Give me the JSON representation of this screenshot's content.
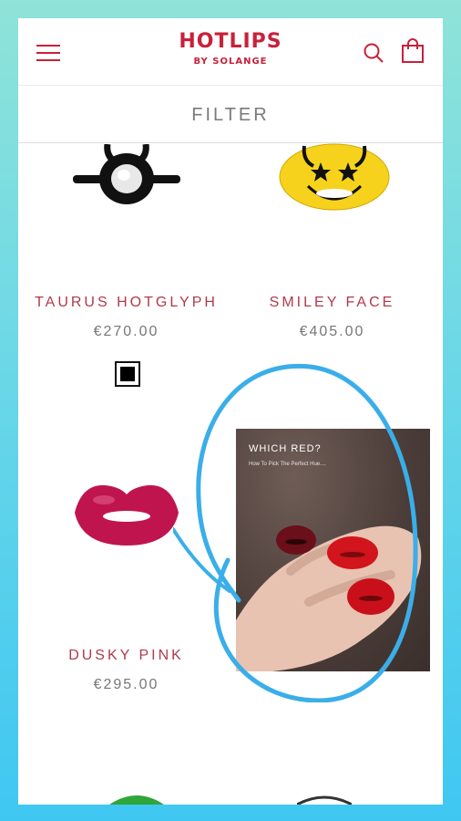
{
  "header": {
    "logo_main": "HOTLIPS",
    "logo_sub": "BY SOLANGE",
    "brand_color": "#c8213b",
    "icons": [
      "menu-icon",
      "search-icon",
      "bag-icon"
    ]
  },
  "filter": {
    "label": "FILTER"
  },
  "products": [
    {
      "name": "TAURUS HOTGLYPH",
      "price": "€270.00",
      "swatch_color": "#000000"
    },
    {
      "name": "SMILEY FACE",
      "price": "€405.00"
    },
    {
      "name": "DUSKY PINK",
      "price": "€295.00"
    }
  ],
  "video": {
    "title": "WHICH RED?",
    "subtitle": "How To Pick The Perfect Hue...."
  },
  "colors": {
    "product_name": "#b03a4b",
    "highlight_circle": "#3aaee8"
  }
}
